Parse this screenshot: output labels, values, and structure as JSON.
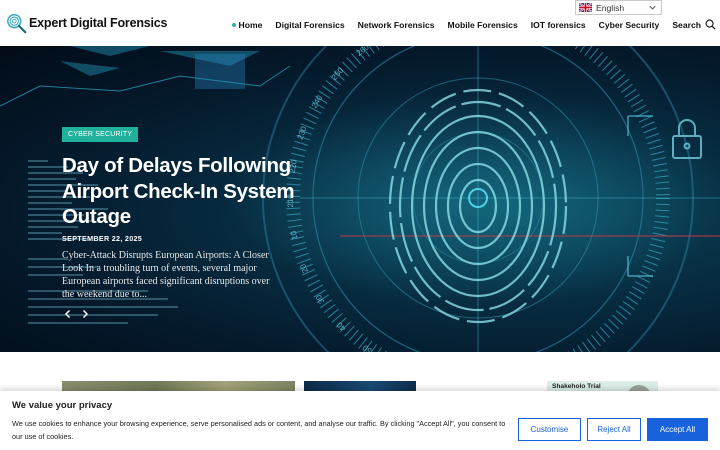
{
  "header": {
    "site_title": "Expert Digital Forensics",
    "nav": [
      {
        "label": "Home",
        "active": true
      },
      {
        "label": "Digital Forensics"
      },
      {
        "label": "Network Forensics"
      },
      {
        "label": "Mobile Forensics"
      },
      {
        "label": "IOT forensics"
      },
      {
        "label": "Cyber Security"
      },
      {
        "label": "Search"
      }
    ],
    "language": "English"
  },
  "hero": {
    "category": "CYBER SECURITY",
    "title": "Day of Delays Following Airport Check-In System Outage",
    "date": "SEPTEMBER 22, 2025",
    "excerpt": "Cyber-Attack Disrupts European Airports: A Closer Look In a troubling turn of events, several major European airports faced significant disruptions over the weekend due to...",
    "dial_numbers": [
      "300",
      "310",
      "290",
      "280",
      "270",
      "260",
      "250",
      "240",
      "230",
      "220",
      "210",
      "10",
      "20",
      "30",
      "40",
      "50",
      "60",
      "70"
    ]
  },
  "sidebar_card": {
    "label": "Shakeholo Trial"
  },
  "cookie": {
    "title": "We value your privacy",
    "text": "We use cookies to enhance your browsing experience, serve personalised ads or content, and analyse our traffic. By clicking \"Accept All\", you consent to our use of cookies.",
    "customise": "Customise",
    "reject": "Reject All",
    "accept": "Accept All"
  },
  "colors": {
    "accent": "#20b09c",
    "cookie_button": "#1863dc",
    "hero_dark": "#04182a"
  }
}
